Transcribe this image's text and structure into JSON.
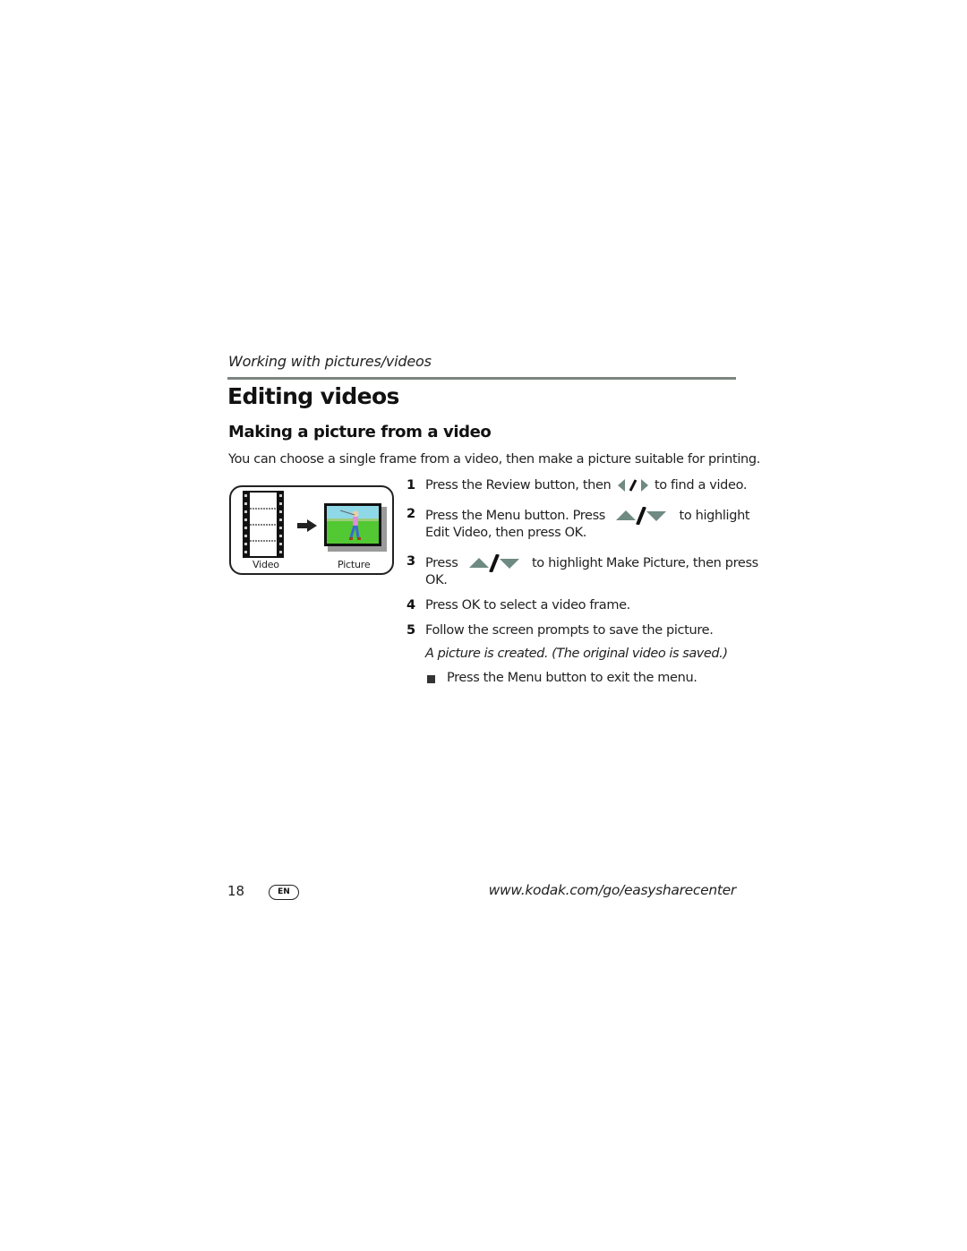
{
  "header": {
    "section": "Working with pictures/videos",
    "title": "Editing videos",
    "subtitle": "Making a picture from a video"
  },
  "intro": "You can choose a single frame from a video, then make a picture suitable for printing.",
  "figure": {
    "left_label": "Video",
    "right_label": "Picture",
    "left_icon": "film-strip-icon",
    "arrow_icon": "arrow-right-icon",
    "right_icon": "golfer-picture-icon"
  },
  "steps": [
    {
      "num": "1",
      "before": "Press the Review button, then",
      "icon": "left-right-arrows-icon",
      "after": "to find a video."
    },
    {
      "num": "2",
      "before": "Press the Menu button. Press",
      "icon": "up-down-arrows-icon",
      "after": "to highlight",
      "line2": "Edit Video, then press OK."
    },
    {
      "num": "3",
      "before": "Press",
      "icon": "up-down-arrows-icon",
      "after": "to highlight Make Picture, then press",
      "line2": "OK."
    },
    {
      "num": "4",
      "text": "Press OK to select a video frame."
    },
    {
      "num": "5",
      "text": "Follow the screen prompts to save the picture."
    }
  ],
  "note": "A picture is created. (The original video is saved.)",
  "bullet": "Press the Menu button to exit the menu.",
  "footer": {
    "page_number": "18",
    "language": "EN",
    "url": "www.kodak.com/go/easysharecenter"
  },
  "colors": {
    "rule": "#7d8580",
    "arrow_icon": "#6f8a82"
  }
}
